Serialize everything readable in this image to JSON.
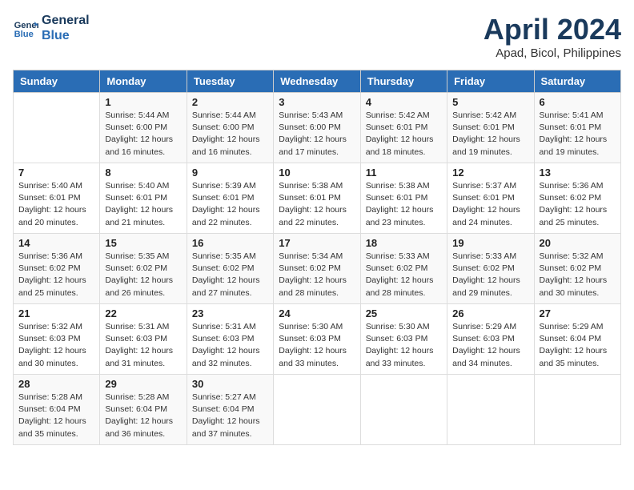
{
  "header": {
    "logo_line1": "General",
    "logo_line2": "Blue",
    "month_title": "April 2024",
    "location": "Apad, Bicol, Philippines"
  },
  "columns": [
    "Sunday",
    "Monday",
    "Tuesday",
    "Wednesday",
    "Thursday",
    "Friday",
    "Saturday"
  ],
  "weeks": [
    [
      {
        "day": "",
        "info": ""
      },
      {
        "day": "1",
        "info": "Sunrise: 5:44 AM\nSunset: 6:00 PM\nDaylight: 12 hours\nand 16 minutes."
      },
      {
        "day": "2",
        "info": "Sunrise: 5:44 AM\nSunset: 6:00 PM\nDaylight: 12 hours\nand 16 minutes."
      },
      {
        "day": "3",
        "info": "Sunrise: 5:43 AM\nSunset: 6:00 PM\nDaylight: 12 hours\nand 17 minutes."
      },
      {
        "day": "4",
        "info": "Sunrise: 5:42 AM\nSunset: 6:01 PM\nDaylight: 12 hours\nand 18 minutes."
      },
      {
        "day": "5",
        "info": "Sunrise: 5:42 AM\nSunset: 6:01 PM\nDaylight: 12 hours\nand 19 minutes."
      },
      {
        "day": "6",
        "info": "Sunrise: 5:41 AM\nSunset: 6:01 PM\nDaylight: 12 hours\nand 19 minutes."
      }
    ],
    [
      {
        "day": "7",
        "info": "Sunrise: 5:40 AM\nSunset: 6:01 PM\nDaylight: 12 hours\nand 20 minutes."
      },
      {
        "day": "8",
        "info": "Sunrise: 5:40 AM\nSunset: 6:01 PM\nDaylight: 12 hours\nand 21 minutes."
      },
      {
        "day": "9",
        "info": "Sunrise: 5:39 AM\nSunset: 6:01 PM\nDaylight: 12 hours\nand 22 minutes."
      },
      {
        "day": "10",
        "info": "Sunrise: 5:38 AM\nSunset: 6:01 PM\nDaylight: 12 hours\nand 22 minutes."
      },
      {
        "day": "11",
        "info": "Sunrise: 5:38 AM\nSunset: 6:01 PM\nDaylight: 12 hours\nand 23 minutes."
      },
      {
        "day": "12",
        "info": "Sunrise: 5:37 AM\nSunset: 6:01 PM\nDaylight: 12 hours\nand 24 minutes."
      },
      {
        "day": "13",
        "info": "Sunrise: 5:36 AM\nSunset: 6:02 PM\nDaylight: 12 hours\nand 25 minutes."
      }
    ],
    [
      {
        "day": "14",
        "info": "Sunrise: 5:36 AM\nSunset: 6:02 PM\nDaylight: 12 hours\nand 25 minutes."
      },
      {
        "day": "15",
        "info": "Sunrise: 5:35 AM\nSunset: 6:02 PM\nDaylight: 12 hours\nand 26 minutes."
      },
      {
        "day": "16",
        "info": "Sunrise: 5:35 AM\nSunset: 6:02 PM\nDaylight: 12 hours\nand 27 minutes."
      },
      {
        "day": "17",
        "info": "Sunrise: 5:34 AM\nSunset: 6:02 PM\nDaylight: 12 hours\nand 28 minutes."
      },
      {
        "day": "18",
        "info": "Sunrise: 5:33 AM\nSunset: 6:02 PM\nDaylight: 12 hours\nand 28 minutes."
      },
      {
        "day": "19",
        "info": "Sunrise: 5:33 AM\nSunset: 6:02 PM\nDaylight: 12 hours\nand 29 minutes."
      },
      {
        "day": "20",
        "info": "Sunrise: 5:32 AM\nSunset: 6:02 PM\nDaylight: 12 hours\nand 30 minutes."
      }
    ],
    [
      {
        "day": "21",
        "info": "Sunrise: 5:32 AM\nSunset: 6:03 PM\nDaylight: 12 hours\nand 30 minutes."
      },
      {
        "day": "22",
        "info": "Sunrise: 5:31 AM\nSunset: 6:03 PM\nDaylight: 12 hours\nand 31 minutes."
      },
      {
        "day": "23",
        "info": "Sunrise: 5:31 AM\nSunset: 6:03 PM\nDaylight: 12 hours\nand 32 minutes."
      },
      {
        "day": "24",
        "info": "Sunrise: 5:30 AM\nSunset: 6:03 PM\nDaylight: 12 hours\nand 33 minutes."
      },
      {
        "day": "25",
        "info": "Sunrise: 5:30 AM\nSunset: 6:03 PM\nDaylight: 12 hours\nand 33 minutes."
      },
      {
        "day": "26",
        "info": "Sunrise: 5:29 AM\nSunset: 6:03 PM\nDaylight: 12 hours\nand 34 minutes."
      },
      {
        "day": "27",
        "info": "Sunrise: 5:29 AM\nSunset: 6:04 PM\nDaylight: 12 hours\nand 35 minutes."
      }
    ],
    [
      {
        "day": "28",
        "info": "Sunrise: 5:28 AM\nSunset: 6:04 PM\nDaylight: 12 hours\nand 35 minutes."
      },
      {
        "day": "29",
        "info": "Sunrise: 5:28 AM\nSunset: 6:04 PM\nDaylight: 12 hours\nand 36 minutes."
      },
      {
        "day": "30",
        "info": "Sunrise: 5:27 AM\nSunset: 6:04 PM\nDaylight: 12 hours\nand 37 minutes."
      },
      {
        "day": "",
        "info": ""
      },
      {
        "day": "",
        "info": ""
      },
      {
        "day": "",
        "info": ""
      },
      {
        "day": "",
        "info": ""
      }
    ]
  ]
}
